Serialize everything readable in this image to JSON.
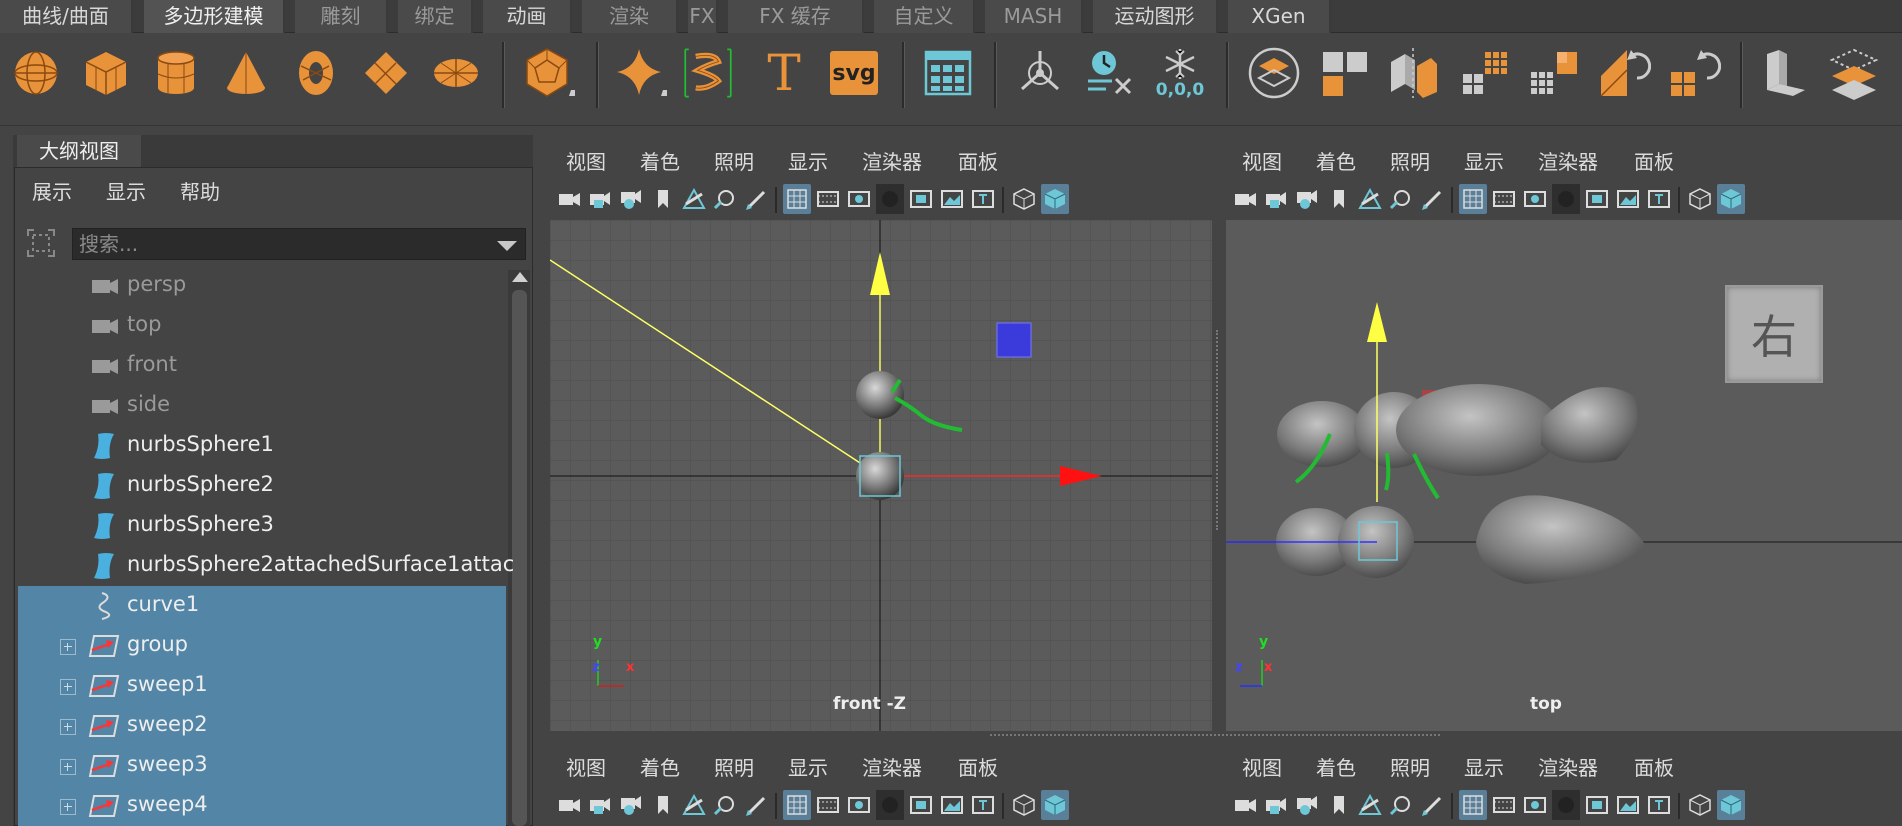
{
  "tabs": [
    {
      "label": "曲线/曲面",
      "state": "normal"
    },
    {
      "label": "多边形建模",
      "state": "active"
    },
    {
      "label": "雕刻",
      "state": "dim"
    },
    {
      "label": "绑定",
      "state": "dim"
    },
    {
      "label": "动画",
      "state": "normal"
    },
    {
      "label": "渲染",
      "state": "dim"
    },
    {
      "label": "FX",
      "state": "dim"
    },
    {
      "label": "FX 缓存",
      "state": "dim"
    },
    {
      "label": "自定义",
      "state": "dim"
    },
    {
      "label": "MASH",
      "state": "dim"
    },
    {
      "label": "运动图形",
      "state": "normal"
    },
    {
      "label": "XGen",
      "state": "normal"
    }
  ],
  "shelf": {
    "icons": [
      "poly-sphere-icon",
      "poly-cube-icon",
      "poly-cylinder-icon",
      "poly-cone-icon",
      "poly-torus-icon",
      "poly-plane-icon",
      "poly-disc-icon",
      "platonic-solid-icon",
      "super-shape-icon",
      "sweep-mesh-icon",
      "type-text-icon",
      "svg-icon",
      "poly-grid-icon",
      "center-pivot-icon",
      "delete-history-icon",
      "freeze-transform-icon",
      "combine-icon",
      "separate-icon",
      "extract-icon",
      "smooth-icon",
      "boolean-icon",
      "reduce-icon",
      "cleanup-icon",
      "retopologize-icon",
      "extrude-icon",
      "bevel-icon"
    ],
    "type_label": "T",
    "svg_label": "svg",
    "freeze_label": "0,0,0",
    "accent": "#e8923a",
    "teal": "#6ec7d6"
  },
  "outliner": {
    "title": "大纲视图",
    "menu": [
      "展示",
      "显示",
      "帮助"
    ],
    "search_placeholder": "搜索...",
    "items": [
      {
        "label": "persp",
        "icon": "camera-icon",
        "dim": true,
        "selected": false,
        "expand": false
      },
      {
        "label": "top",
        "icon": "camera-icon",
        "dim": true,
        "selected": false,
        "expand": false
      },
      {
        "label": "front",
        "icon": "camera-icon",
        "dim": true,
        "selected": false,
        "expand": false
      },
      {
        "label": "side",
        "icon": "camera-icon",
        "dim": true,
        "selected": false,
        "expand": false
      },
      {
        "label": "nurbsSphere1",
        "icon": "nurbs-surface-icon",
        "dim": false,
        "selected": false,
        "expand": false
      },
      {
        "label": "nurbsSphere2",
        "icon": "nurbs-surface-icon",
        "dim": false,
        "selected": false,
        "expand": false
      },
      {
        "label": "nurbsSphere3",
        "icon": "nurbs-surface-icon",
        "dim": false,
        "selected": false,
        "expand": false
      },
      {
        "label": "nurbsSphere2attachedSurface1attac",
        "icon": "nurbs-surface-icon",
        "dim": false,
        "selected": false,
        "expand": false
      },
      {
        "label": "curve1",
        "icon": "curve-icon",
        "dim": false,
        "selected": true,
        "expand": false
      },
      {
        "label": "group",
        "icon": "sweep-icon",
        "dim": false,
        "selected": true,
        "expand": true
      },
      {
        "label": "sweep1",
        "icon": "sweep-icon",
        "dim": false,
        "selected": true,
        "expand": true
      },
      {
        "label": "sweep2",
        "icon": "sweep-icon",
        "dim": false,
        "selected": true,
        "expand": true
      },
      {
        "label": "sweep3",
        "icon": "sweep-icon",
        "dim": false,
        "selected": true,
        "expand": true
      },
      {
        "label": "sweep4",
        "icon": "sweep-icon",
        "dim": false,
        "selected": true,
        "expand": true
      }
    ]
  },
  "viewport_menu": [
    "视图",
    "着色",
    "照明",
    "显示",
    "渲染器",
    "面板"
  ],
  "viewports": [
    {
      "label": "front -Z",
      "axis_h": "z",
      "axis_h2": "x",
      "axis_v": "y"
    },
    {
      "label": "top",
      "axis_h": "z",
      "axis_h2": "x",
      "axis_v": "y"
    }
  ],
  "view_cube_label": "右",
  "colors": {
    "selection": "#5285a6",
    "viewport_bg": "#5b5b5b",
    "grid": "#4e4e4e",
    "axis_y": "#ffff66",
    "axis_x": "#ff2222",
    "axis_z": "#2222ff",
    "curve": "#22bb33"
  }
}
